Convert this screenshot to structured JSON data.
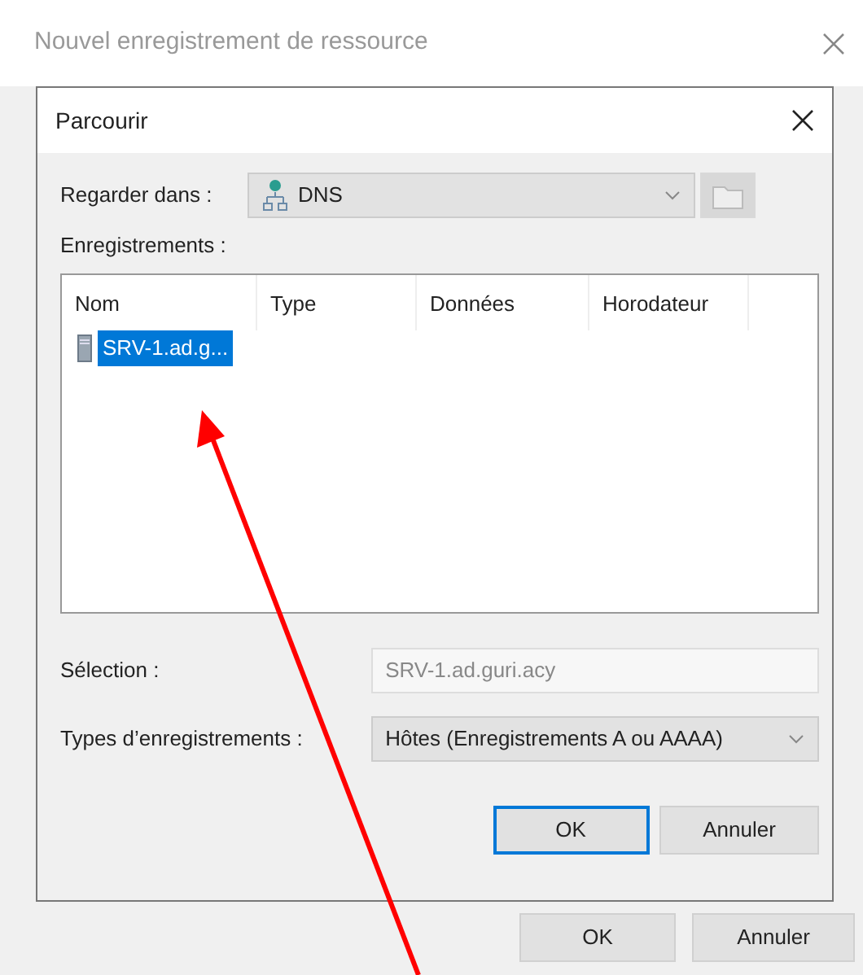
{
  "window": {
    "title": "Nouvel enregistrement de ressource"
  },
  "dialog": {
    "title": "Parcourir",
    "look_in": {
      "label": "Regarder dans :",
      "value": "DNS"
    },
    "records_label": "Enregistrements :",
    "columns": [
      "Nom",
      "Type",
      "Données",
      "Horodateur"
    ],
    "rows": [
      {
        "name": "SRV-1.ad.g...",
        "selected": true
      }
    ],
    "selection": {
      "label": "Sélection :",
      "value": "SRV-1.ad.guri.acy",
      "disabled": true
    },
    "record_types": {
      "label": "Types d’enregistrements :",
      "value": "Hôtes (Enregistrements A ou AAAA)"
    },
    "buttons": [
      {
        "label": "OK",
        "focused": true
      },
      {
        "label": "Annuler",
        "focused": false
      }
    ]
  },
  "buttons": [
    {
      "label": "OK"
    },
    {
      "label": "Annuler"
    }
  ],
  "annotations": [
    {
      "kind": "arrow"
    }
  ]
}
